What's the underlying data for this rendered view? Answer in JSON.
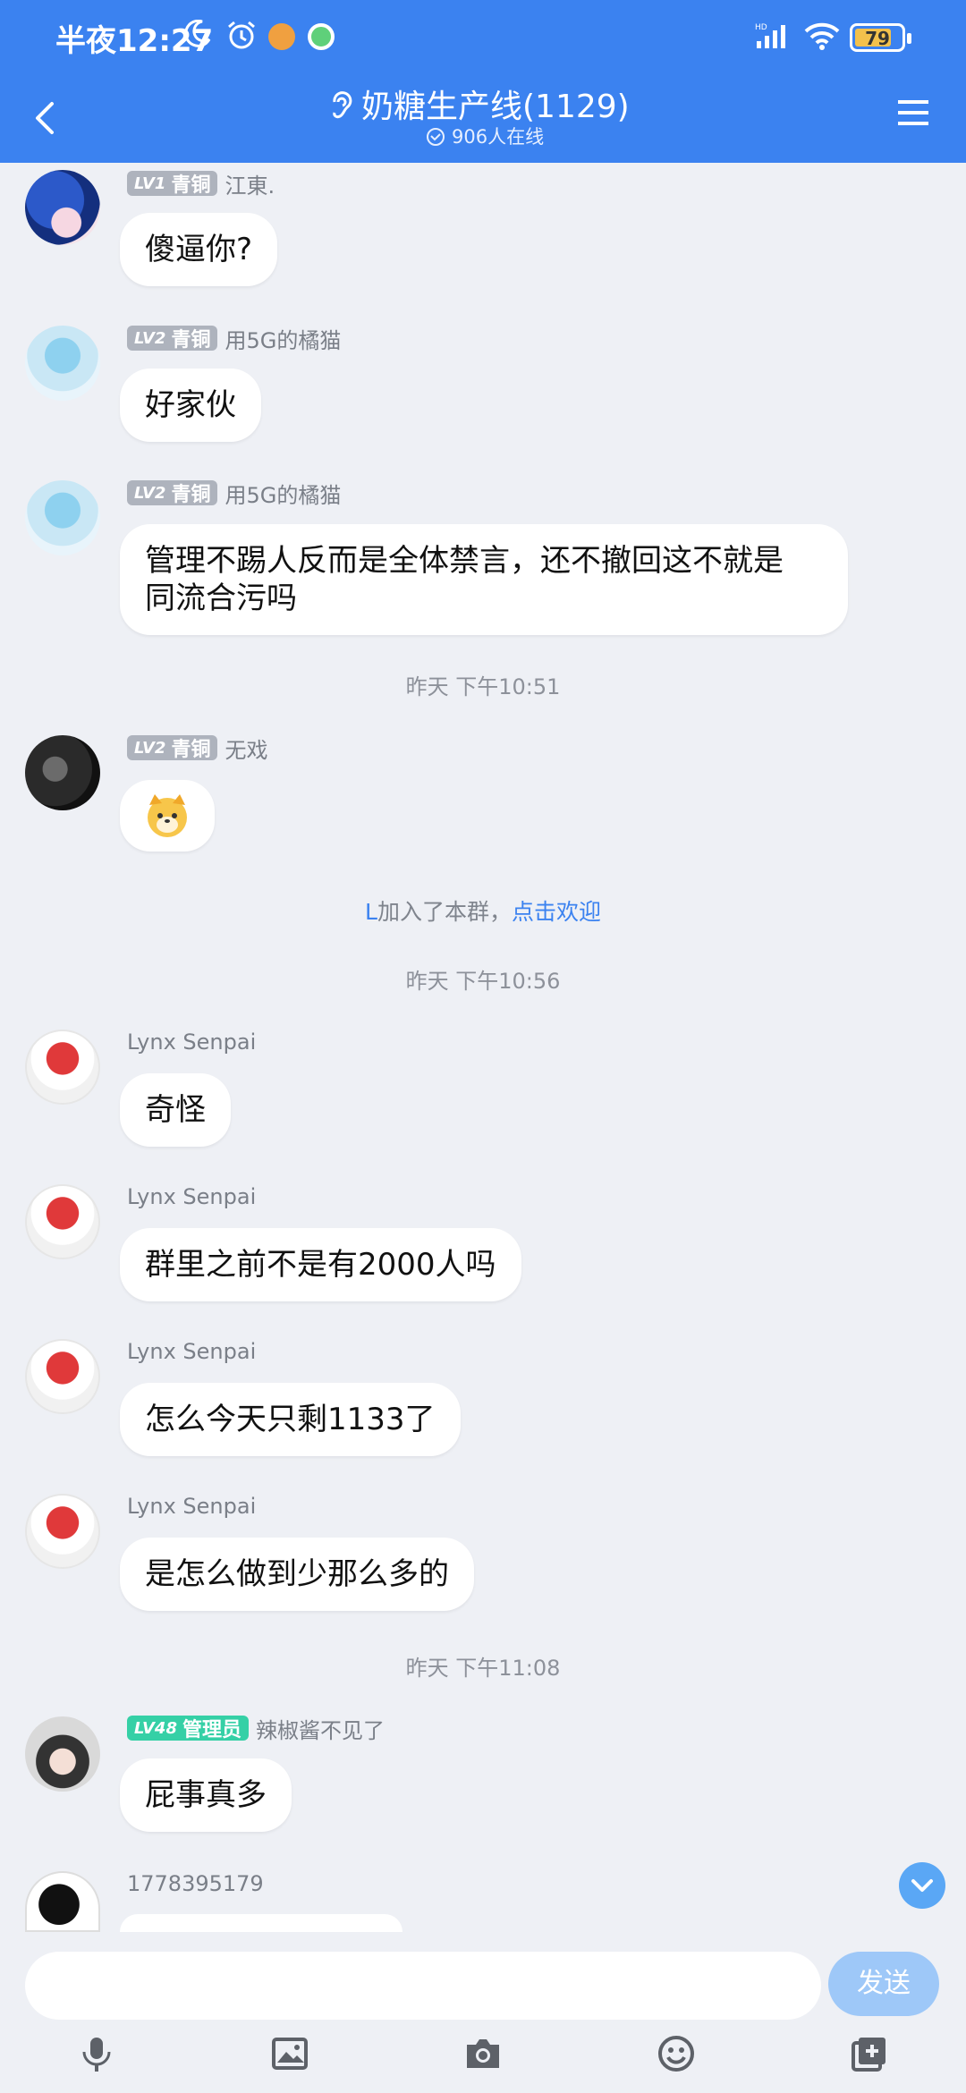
{
  "status_bar": {
    "time": "半夜12:27",
    "battery": "79",
    "network_label": "HD"
  },
  "header": {
    "title": "奶糖生产线(1129)",
    "online": "906人在线"
  },
  "messages": [
    {
      "level": "LV1",
      "rank": "青铜",
      "sender": "江東.",
      "text": "傻逼你?"
    },
    {
      "level": "LV2",
      "rank": "青铜",
      "sender": "用5G的橘猫",
      "text": "好家伙"
    },
    {
      "level": "LV2",
      "rank": "青铜",
      "sender": "用5G的橘猫",
      "text_line1": "管理不踢人反而是全体禁言，还不撤回这不就是",
      "text_line2": "同流合污吗"
    },
    {
      "level": "LV2",
      "rank": "青铜",
      "sender": "无戏"
    },
    {
      "sender": "Lynx Senpai",
      "text": "奇怪"
    },
    {
      "sender": "Lynx Senpai",
      "text": "群里之前不是有2000人吗"
    },
    {
      "sender": "Lynx Senpai",
      "text": "怎么今天只剩1133了"
    },
    {
      "sender": "Lynx Senpai",
      "text": "是怎么做到少那么多的"
    },
    {
      "level": "LV48",
      "rank": "管理员",
      "sender": "辣椒酱不见了",
      "text": "屁事真多"
    },
    {
      "sender": "1778395179"
    }
  ],
  "timestamps": [
    "昨天  下午10:51",
    "昨天  下午10:56",
    "昨天  下午11:08"
  ],
  "join_notice": {
    "name": "L",
    "text": "加入了本群，",
    "link": "点击欢迎"
  },
  "composer": {
    "send_label": "发送"
  },
  "icons": [
    "back-icon",
    "ear-icon",
    "menu-icon",
    "mic-icon",
    "image-icon",
    "camera-icon",
    "emoji-icon",
    "more-icon",
    "scroll-down-icon"
  ]
}
